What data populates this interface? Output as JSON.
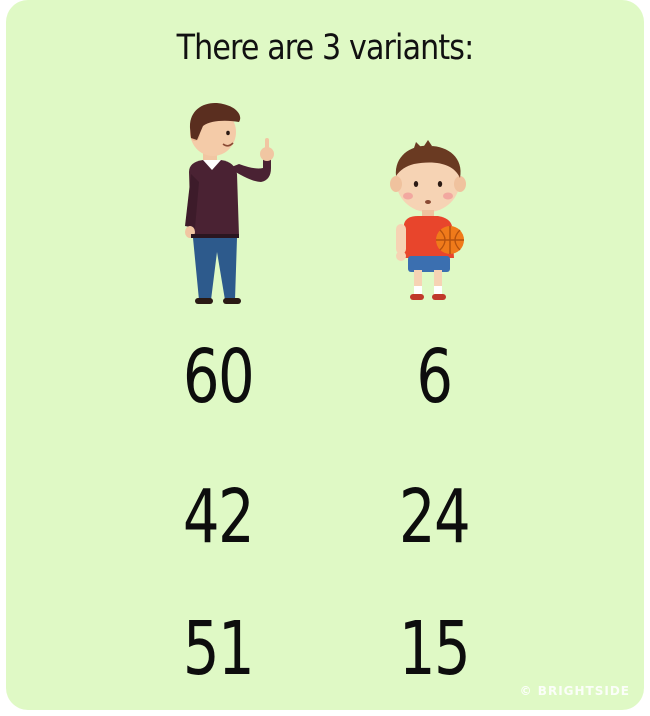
{
  "title": "There are 3 variants:",
  "variants": [
    {
      "man": "60",
      "boy": "6"
    },
    {
      "man": "42",
      "boy": "24"
    },
    {
      "man": "51",
      "boy": "15"
    }
  ],
  "watermark": "© BRIGHTSIDE",
  "colors": {
    "background": "#dff9c5",
    "text": "#0d0d0d",
    "man_sweater": "#4a2233",
    "man_jeans": "#2d5a8c",
    "boy_shirt": "#e8452c",
    "ball": "#f07a1a"
  }
}
